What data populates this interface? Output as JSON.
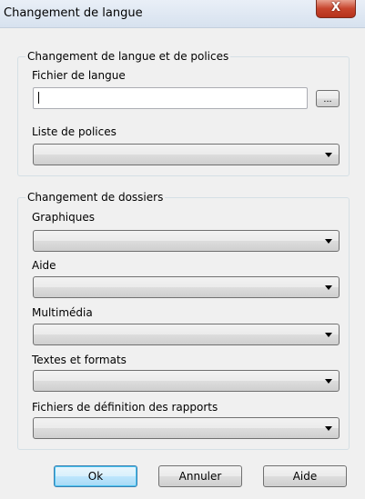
{
  "window": {
    "title": "Changement de langue",
    "close_glyph": "X"
  },
  "group_language": {
    "legend": "Changement de langue et de polices",
    "language_file_label": "Fichier de langue",
    "language_file_value": "",
    "browse_label": "...",
    "font_list_label": "Liste de polices",
    "font_list_value": ""
  },
  "group_folders": {
    "legend": "Changement de dossiers",
    "fields": [
      {
        "label": "Graphiques",
        "value": ""
      },
      {
        "label": "Aide",
        "value": ""
      },
      {
        "label": "Multimédia",
        "value": ""
      },
      {
        "label": "Textes et formats",
        "value": ""
      },
      {
        "label": "Fichiers de définition des rapports",
        "value": ""
      }
    ]
  },
  "buttons": {
    "ok": "Ok",
    "cancel": "Annuler",
    "help": "Aide"
  }
}
